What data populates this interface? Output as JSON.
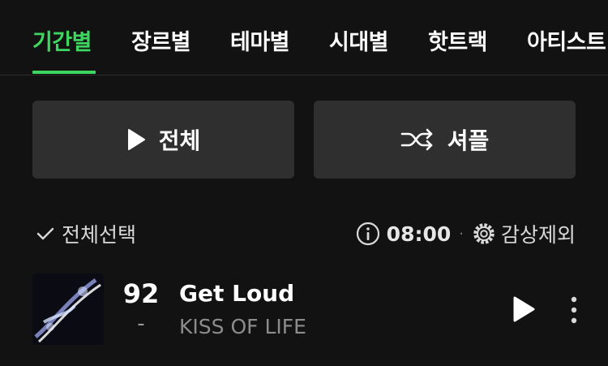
{
  "tabs": [
    {
      "label": "기간별",
      "active": true
    },
    {
      "label": "장르별",
      "active": false
    },
    {
      "label": "테마별",
      "active": false
    },
    {
      "label": "시대별",
      "active": false
    },
    {
      "label": "핫트랙",
      "active": false
    },
    {
      "label": "아티스트",
      "active": false
    }
  ],
  "actions": {
    "play_all_label": "전체",
    "shuffle_label": "셔플"
  },
  "selection": {
    "select_all_label": "전체선택",
    "duration": "08:00",
    "separator": "·",
    "exclude_label": "감상제외"
  },
  "tracks": [
    {
      "rank": "92",
      "change": "-",
      "title": "Get Loud",
      "artist": "KISS OF LIFE"
    }
  ],
  "icons": {
    "play": "play-icon",
    "shuffle": "shuffle-icon",
    "check": "check-icon",
    "info": "info-icon",
    "gear": "gear-icon",
    "more": "more-vertical-icon"
  },
  "colors": {
    "accent": "#3dd660",
    "background": "#121212",
    "button": "#2f2f2f",
    "muted": "#8c8c8c"
  }
}
